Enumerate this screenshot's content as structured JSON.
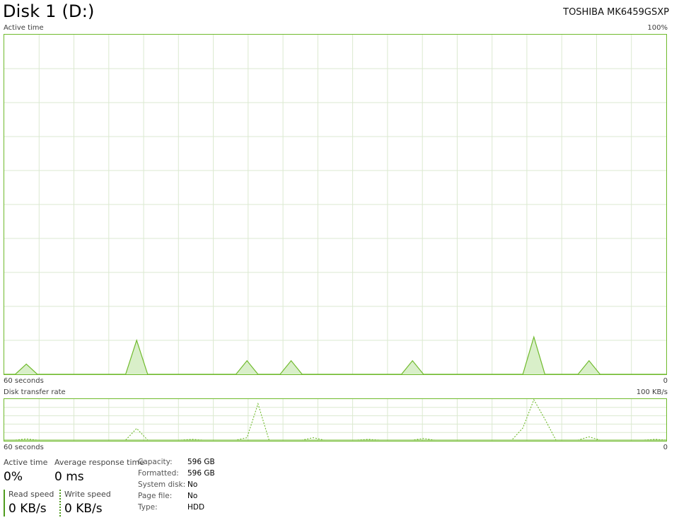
{
  "header": {
    "title": "Disk 1 (D:)",
    "model": "TOSHIBA MK6459GSXP"
  },
  "active_time_graph": {
    "label": "Active time",
    "max_label": "100%",
    "x_start_label": "60 seconds",
    "x_end_label": "0",
    "color": "#6fba2c",
    "fill_color": "#d9efc9",
    "grid_color": "#dbe9d0"
  },
  "transfer_graph": {
    "label": "Disk transfer rate",
    "max_label": "100 KB/s",
    "x_start_label": "60 seconds",
    "x_end_label": "0"
  },
  "chart_data": [
    {
      "type": "area",
      "title": "Active time",
      "xlabel": "60 seconds → 0",
      "ylim": [
        0,
        100
      ],
      "x_range_seconds": [
        60,
        0
      ],
      "series": [
        {
          "name": "Active time",
          "x": [
            0,
            1,
            2,
            3,
            4,
            5,
            6,
            7,
            8,
            9,
            10,
            11,
            12,
            13,
            14,
            15,
            16,
            17,
            18,
            19,
            20,
            21,
            22,
            23,
            24,
            25,
            26,
            27,
            28,
            29,
            30,
            31,
            32,
            33,
            34,
            35,
            36,
            37,
            38,
            39,
            40,
            41,
            42,
            43,
            44,
            45,
            46,
            47,
            48,
            49,
            50,
            51,
            52,
            53,
            54,
            55,
            56,
            57,
            58,
            59,
            60
          ],
          "values": [
            0,
            0,
            3,
            0,
            0,
            0,
            0,
            0,
            0,
            0,
            0,
            0,
            10,
            0,
            0,
            0,
            0,
            0,
            0,
            0,
            0,
            0,
            4,
            0,
            0,
            0,
            4,
            0,
            0,
            0,
            0,
            0,
            0,
            0,
            0,
            0,
            0,
            4,
            0,
            0,
            0,
            0,
            0,
            0,
            0,
            0,
            0,
            0,
            11,
            0,
            0,
            0,
            0,
            4,
            0,
            0,
            0,
            0,
            0,
            0,
            0
          ]
        }
      ]
    },
    {
      "type": "line",
      "title": "Disk transfer rate",
      "xlabel": "60 seconds → 0",
      "ylim": [
        0,
        100
      ],
      "x_range_seconds": [
        60,
        0
      ],
      "series": [
        {
          "name": "Read speed",
          "x": [
            0,
            60
          ],
          "values": [
            0,
            0
          ]
        },
        {
          "name": "Write speed",
          "x": [
            0,
            1,
            2,
            3,
            4,
            5,
            6,
            7,
            8,
            9,
            10,
            11,
            12,
            13,
            14,
            15,
            16,
            17,
            18,
            19,
            20,
            21,
            22,
            23,
            24,
            25,
            26,
            27,
            28,
            29,
            30,
            31,
            32,
            33,
            34,
            35,
            36,
            37,
            38,
            39,
            40,
            41,
            42,
            43,
            44,
            45,
            46,
            47,
            48,
            49,
            50,
            51,
            52,
            53,
            54,
            55,
            56,
            57,
            58,
            59,
            60
          ],
          "values": [
            0,
            0,
            3,
            0,
            0,
            0,
            0,
            0,
            0,
            0,
            0,
            0,
            29,
            0,
            0,
            0,
            0,
            2,
            0,
            0,
            0,
            0,
            6,
            90,
            0,
            0,
            0,
            0,
            6,
            0,
            0,
            0,
            0,
            2,
            0,
            0,
            0,
            0,
            4,
            0,
            0,
            0,
            0,
            0,
            0,
            0,
            0,
            30,
            100,
            52,
            0,
            0,
            0,
            8,
            0,
            0,
            0,
            0,
            0,
            2,
            0
          ]
        }
      ]
    }
  ],
  "stats": {
    "active_time_label": "Active time",
    "active_time_value": "0%",
    "avg_response_label": "Average response time",
    "avg_response_value": "0 ms",
    "read_speed_label": "Read speed",
    "read_speed_value": "0 KB/s",
    "write_speed_label": "Write speed",
    "write_speed_value": "0 KB/s"
  },
  "info": [
    {
      "key": "Capacity:",
      "value": "596 GB"
    },
    {
      "key": "Formatted:",
      "value": "596 GB"
    },
    {
      "key": "System disk:",
      "value": "No"
    },
    {
      "key": "Page file:",
      "value": "No"
    },
    {
      "key": "Type:",
      "value": "HDD"
    }
  ]
}
